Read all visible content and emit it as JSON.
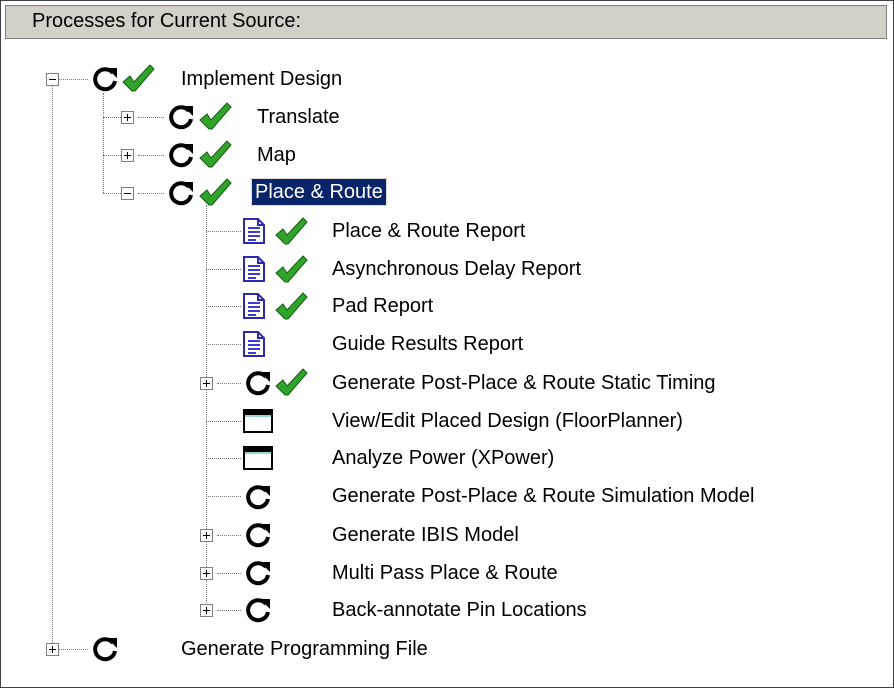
{
  "panel": {
    "title": "Processes for Current Source:"
  },
  "tree": [
    {
      "label": "Implement Design",
      "expander": "minus",
      "icons": [
        "refresh-icon",
        "check-icon"
      ]
    },
    {
      "label": "Translate",
      "expander": "plus",
      "icons": [
        "refresh-icon",
        "check-icon"
      ]
    },
    {
      "label": "Map",
      "expander": "plus",
      "icons": [
        "refresh-icon",
        "check-icon"
      ]
    },
    {
      "label": "Place & Route",
      "expander": "minus",
      "icons": [
        "refresh-icon",
        "check-icon"
      ],
      "selected": true
    },
    {
      "label": "Place & Route Report",
      "icons": [
        "report-icon",
        "check-icon"
      ]
    },
    {
      "label": "Asynchronous Delay Report",
      "icons": [
        "report-icon",
        "check-icon"
      ]
    },
    {
      "label": "Pad Report",
      "icons": [
        "report-icon",
        "check-icon"
      ]
    },
    {
      "label": "Guide Results Report",
      "icons": [
        "report-icon"
      ]
    },
    {
      "label": "Generate Post-Place & Route Static Timing",
      "expander": "plus",
      "icons": [
        "refresh-icon",
        "check-icon"
      ]
    },
    {
      "label": "View/Edit Placed Design (FloorPlanner)",
      "icons": [
        "window-icon"
      ]
    },
    {
      "label": "Analyze Power (XPower)",
      "icons": [
        "window-icon"
      ]
    },
    {
      "label": "Generate Post-Place & Route Simulation Model",
      "icons": [
        "refresh-icon"
      ]
    },
    {
      "label": "Generate IBIS Model",
      "expander": "plus",
      "icons": [
        "refresh-icon"
      ]
    },
    {
      "label": "Multi Pass Place & Route",
      "expander": "plus",
      "icons": [
        "refresh-icon"
      ]
    },
    {
      "label": "Back-annotate Pin Locations",
      "expander": "plus",
      "icons": [
        "refresh-icon"
      ]
    },
    {
      "label": "Generate Programming File",
      "expander": "plus",
      "icons": [
        "refresh-icon"
      ]
    }
  ],
  "colors": {
    "selection": "#0a246a",
    "check": "#2fa32a",
    "report": "#3b3bd8"
  }
}
